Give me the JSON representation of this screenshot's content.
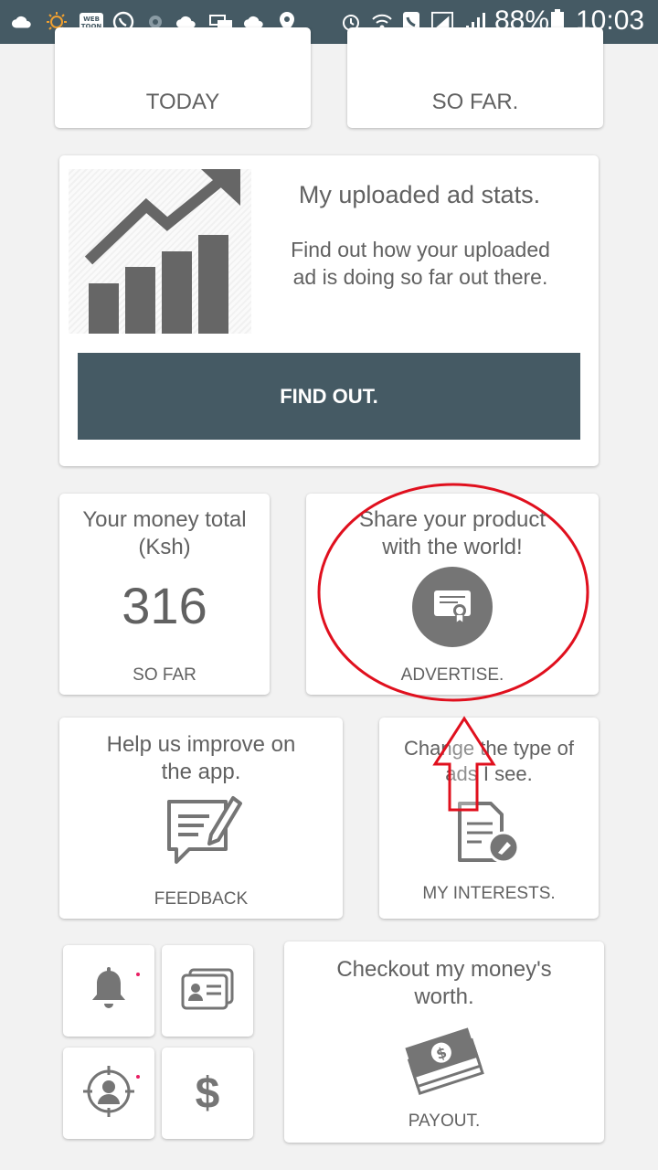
{
  "status_bar": {
    "battery": "88%",
    "time": "10:03",
    "icons": [
      "cloud-icon",
      "brightness-icon",
      "webtoon-icon",
      "whatsapp-icon",
      "settings-icon",
      "cloud-icon",
      "car-icon",
      "cloud-icon",
      "location-icon",
      "alarm-icon",
      "wifi-call-icon",
      "phone-icon",
      "signal-icon",
      "signal-icon",
      "battery-icon"
    ],
    "webtoon_label": "WEB TOON"
  },
  "top_cards": {
    "left_label": "TODAY",
    "right_label": "SO FAR."
  },
  "ad_stats": {
    "title": "My uploaded ad stats.",
    "description": "Find out how your uploaded ad is doing so far out there.",
    "button_label": "FIND OUT.",
    "icon": "chart-trend-icon"
  },
  "money_total": {
    "title": "Your money total (Ksh)",
    "value": "316",
    "caption": "SO FAR"
  },
  "advertise": {
    "title": "Share your product with the world!",
    "caption": "ADVERTISE.",
    "icon": "certificate-icon"
  },
  "feedback": {
    "title": "Help us improve on the app.",
    "caption": "FEEDBACK",
    "icon": "feedback-icon"
  },
  "interests": {
    "title": "Change the type of ads I see.",
    "caption": "MY INTERESTS.",
    "icon": "document-edit-icon"
  },
  "quick_tiles": {
    "icons": [
      "bell-icon",
      "id-card-icon",
      "target-user-icon",
      "dollar-icon"
    ],
    "dollar_glyph": "$"
  },
  "payout": {
    "title": "Checkout my money's worth.",
    "caption": "PAYOUT.",
    "icon": "money-stack-icon"
  },
  "colors": {
    "status_bar": "#455a64",
    "button": "#455a64",
    "annotation": "#e0101e",
    "icon_gray": "#757575"
  }
}
